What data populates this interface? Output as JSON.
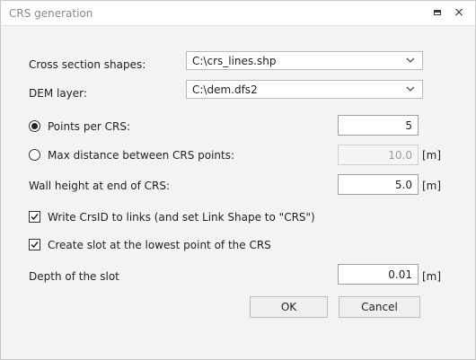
{
  "window": {
    "title": "CRS generation",
    "restore_icon": "restore-icon",
    "close_icon": "close-icon"
  },
  "form": {
    "cross_section_shapes": {
      "label": "Cross section shapes:",
      "value": "C:\\crs_lines.shp"
    },
    "dem_layer": {
      "label": "DEM layer:",
      "value": "C:\\dem.dfs2"
    },
    "points_per_crs": {
      "label": "Points per CRS:",
      "value": "5",
      "selected": true
    },
    "max_distance": {
      "label": "Max distance between CRS points:",
      "value": "10.0",
      "unit": "[m]",
      "selected": false,
      "enabled": false
    },
    "wall_height": {
      "label": "Wall height at end of CRS:",
      "value": "5.0",
      "unit": "[m]"
    },
    "write_crsid": {
      "label": "Write CrsID to links (and set Link Shape to \"CRS\")",
      "checked": true
    },
    "create_slot": {
      "label": "Create slot at the lowest point of the CRS",
      "checked": true
    },
    "slot_depth": {
      "label": "Depth of the slot",
      "value": "0.01",
      "unit": "[m]"
    }
  },
  "buttons": {
    "ok": "OK",
    "cancel": "Cancel"
  }
}
